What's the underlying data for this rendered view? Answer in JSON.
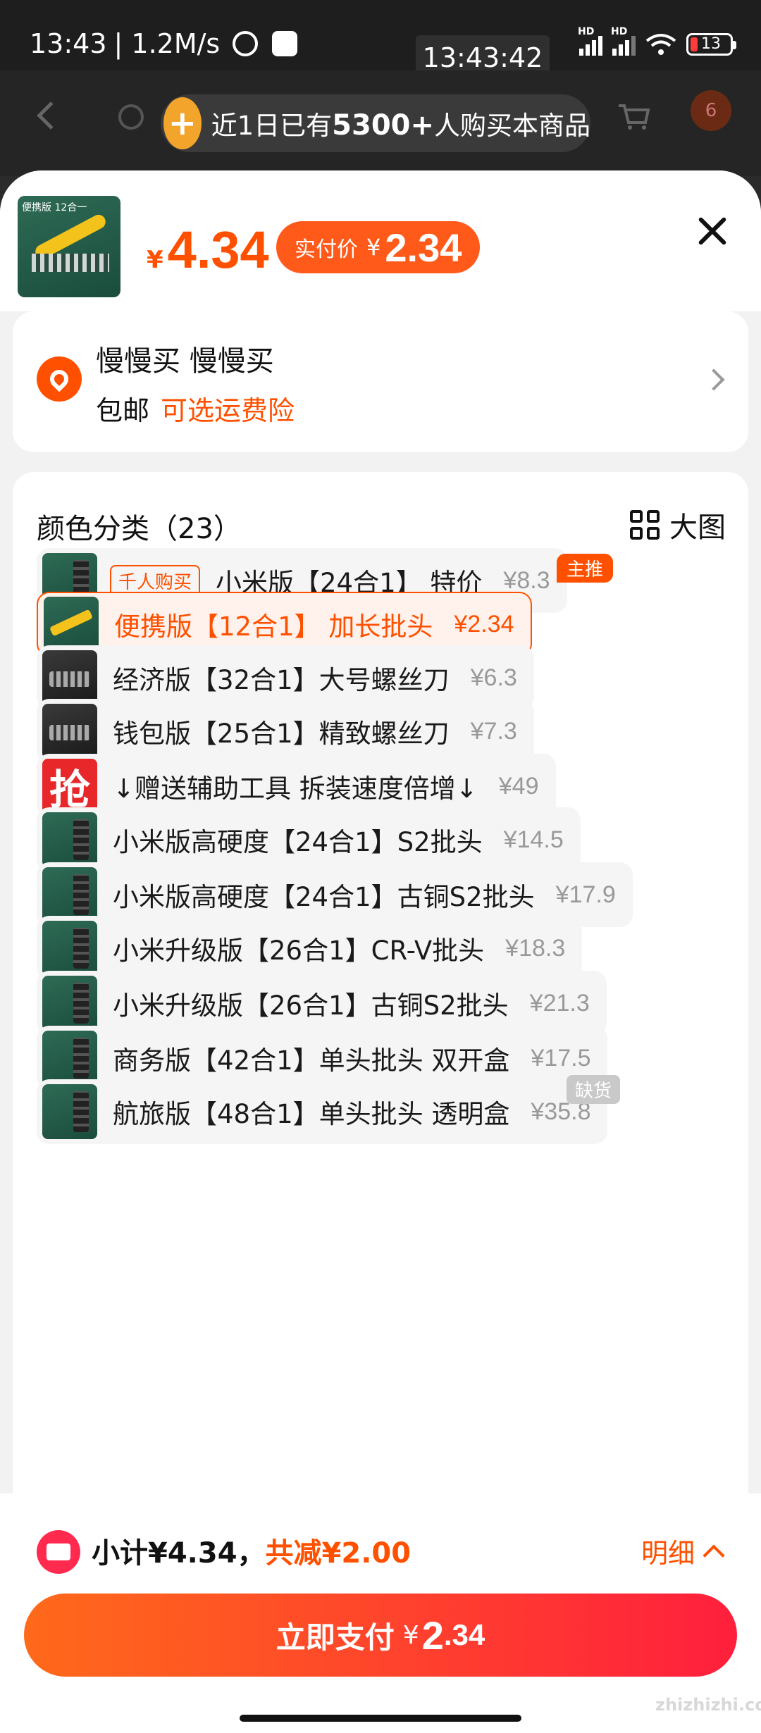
{
  "status_bar": {
    "time": "13:43",
    "speed": "| 1.2M/s",
    "overlay_clock": "13:43:42",
    "battery": "13"
  },
  "header": {
    "banner_prefix": "近1日已有",
    "banner_count": "5300+",
    "banner_suffix": "人购买本商品",
    "cart_badge": "6"
  },
  "product": {
    "thumb_label": "便携版 12合一",
    "price_symbol": "¥",
    "price": "4.34",
    "actual_label": "实付价",
    "actual_symbol": "¥",
    "actual_price": "2.34"
  },
  "address": {
    "name": "慢慢买 慢慢买",
    "shipping": "包邮",
    "insurance": "可选运费险"
  },
  "variants": {
    "title": "颜色分类（23）",
    "big_view": "大图",
    "main_badge": "主推",
    "oos_badge": "缺货",
    "items": [
      {
        "tag": "千人购买",
        "label": "小米版【24合1】 特价",
        "price": "¥8.3"
      },
      {
        "label": "便携版【12合1】 加长批头",
        "price": "¥2.34",
        "selected": true
      },
      {
        "label": "经济版【32合1】大号螺丝刀",
        "price": "¥6.3"
      },
      {
        "label": "钱包版【25合1】精致螺丝刀",
        "price": "¥7.3"
      },
      {
        "thumb_text": "抢",
        "label": "↓赠送辅助工具 拆装速度倍增↓",
        "price": "¥49"
      },
      {
        "label": "小米版高硬度【24合1】S2批头",
        "price": "¥14.5"
      },
      {
        "label": "小米版高硬度【24合1】古铜S2批头",
        "price": "¥17.9"
      },
      {
        "label": "小米升级版【26合1】CR-V批头",
        "price": "¥18.3"
      },
      {
        "label": "小米升级版【26合1】古铜S2批头",
        "price": "¥21.3"
      },
      {
        "label": "商务版【42合1】单头批头 双开盒",
        "price": "¥17.5"
      },
      {
        "label": "航旅版【48合1】单头批头 透明盒",
        "price": "¥35.8"
      }
    ]
  },
  "footer": {
    "subtotal": "小计¥4.34，",
    "discount": "共减¥2.00",
    "detail": "明细",
    "pay_label": "立即支付",
    "pay_symbol": "¥",
    "pay_int": "2",
    "pay_dec": ".34",
    "watermark": "zhizhizhi.com"
  },
  "colors": {
    "accent": "#ff5000",
    "pay_gradient_start": "#ff6a1a",
    "pay_gradient_end": "#ff1f3d"
  }
}
